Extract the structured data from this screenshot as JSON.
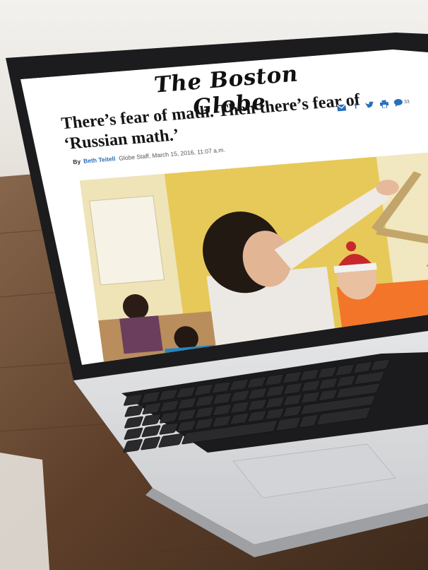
{
  "masthead": "The Boston Globe",
  "article": {
    "headline": "There’s fear of math. Then there’s fear of ‘Russian math.’",
    "byline_prefix": "By",
    "author": "Beth Teitell",
    "meta": "Globe Staff,  March 15, 2016, 11:07 a.m."
  },
  "share": {
    "icons": [
      "email-icon",
      "facebook-icon",
      "twitter-icon",
      "print-icon",
      "comment-icon"
    ],
    "comment_count": "33"
  },
  "colors": {
    "link_blue": "#2a6ebb",
    "desk_wood": "#6b4a32",
    "laptop_bezel": "#1c1c1e",
    "laptop_silver": "#d9dadc"
  }
}
